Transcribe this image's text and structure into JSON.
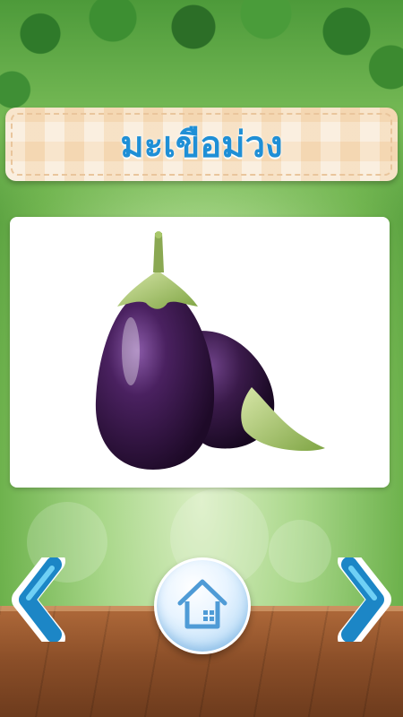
{
  "title": "มะเขือม่วง",
  "image": {
    "subject": "eggplant-image"
  },
  "controls": {
    "prev_icon": "chevron-left-icon",
    "home_icon": "home-icon",
    "next_icon": "chevron-right-icon"
  },
  "colors": {
    "title": "#1f8fd6",
    "banner": "#f7e3c8",
    "nav_blue": "#2aa7e0",
    "eggplant": "#3a1a4a",
    "stem": "#a8c76a"
  }
}
